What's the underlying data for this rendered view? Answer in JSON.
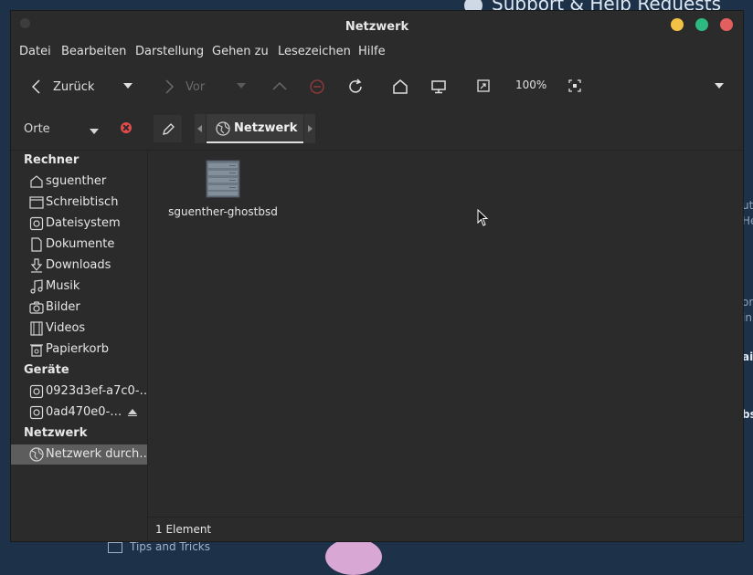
{
  "background": {
    "top_text": "Support & Help Requests",
    "bottom_text": "Tips and Tricks",
    "right_fragments": [
      "ut",
      "He",
      "or",
      "in",
      "ai",
      "bs"
    ]
  },
  "window": {
    "title": "Netzwerk"
  },
  "menu": [
    "Datei",
    "Bearbeiten",
    "Darstellung",
    "Gehen zu",
    "Lesezeichen",
    "Hilfe"
  ],
  "toolbar": {
    "back_label": "Zurück",
    "forward_label": "Vor",
    "zoom": "100%"
  },
  "location": {
    "places_label": "Orte",
    "crumb": "Netzwerk"
  },
  "sidebar": {
    "computer_heading": "Rechner",
    "computer_items": [
      {
        "label": "sguenther",
        "icon": "home-icon"
      },
      {
        "label": "Schreibtisch",
        "icon": "desktop-icon"
      },
      {
        "label": "Dateisystem",
        "icon": "drive-icon"
      },
      {
        "label": "Dokumente",
        "icon": "document-icon"
      },
      {
        "label": "Downloads",
        "icon": "download-icon"
      },
      {
        "label": "Musik",
        "icon": "music-icon"
      },
      {
        "label": "Bilder",
        "icon": "camera-icon"
      },
      {
        "label": "Videos",
        "icon": "film-icon"
      },
      {
        "label": "Papierkorb",
        "icon": "trash-icon"
      }
    ],
    "devices_heading": "Geräte",
    "device_items": [
      {
        "label": "0923d3ef-a7c0-…",
        "icon": "drive-icon"
      },
      {
        "label": "0ad470e0-…",
        "icon": "drive-icon"
      }
    ],
    "network_heading": "Netzwerk",
    "network_items": [
      {
        "label": "Netzwerk durch…",
        "icon": "globe-icon"
      }
    ]
  },
  "content": {
    "files": [
      {
        "name": "sguenther-ghostbsd",
        "icon": "server-icon"
      }
    ]
  },
  "status": "1 Element",
  "colors": {
    "window_bg": "#2b2b2b",
    "selection": "#5d5d5d",
    "minimize": "#f2c245",
    "maximize": "#2eb882",
    "close": "#e35f5f"
  }
}
